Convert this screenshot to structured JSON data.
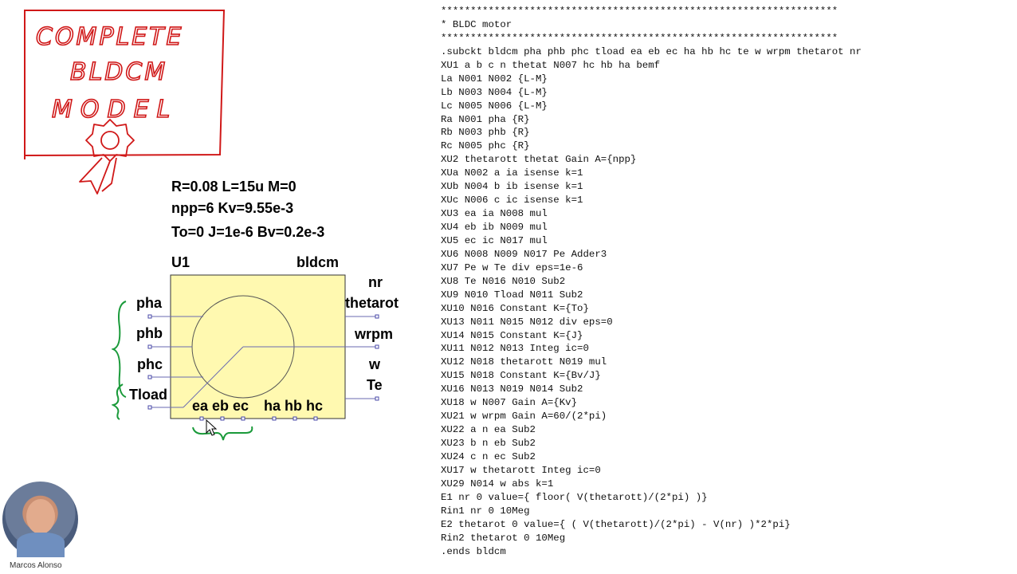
{
  "annotation": {
    "title_lines": [
      "COMPLETE",
      "BLDCM",
      "MODEL"
    ]
  },
  "params": {
    "line1": "R=0.08 L=15u M=0",
    "line2": "npp=6 Kv=9.55e-3",
    "line3": "To=0 J=1e-6 Bv=0.2e-3"
  },
  "symbol": {
    "instance": "U1",
    "model": "bldcm",
    "left_pins": [
      "pha",
      "phb",
      "phc",
      "Tload"
    ],
    "right_pins": [
      "nr",
      "thetarot",
      "wrpm",
      "w",
      "Te"
    ],
    "bottom_pins": "ea eb ec",
    "bottom_pins2": "ha hb hc",
    "fill_color": "#fff9b0",
    "bracket_color": "#1a9a3a"
  },
  "netlist": {
    "lines": [
      "*******************************************************************",
      "* BLDC motor",
      "*******************************************************************",
      ".subckt bldcm pha phb phc tload ea eb ec ha hb hc te w wrpm thetarot nr",
      "XU1 a b c n thetat N007 hc hb ha bemf",
      "La N001 N002 {L-M}",
      "Lb N003 N004 {L-M}",
      "Lc N005 N006 {L-M}",
      "Ra N001 pha {R}",
      "Rb N003 phb {R}",
      "Rc N005 phc {R}",
      "XU2 thetarott thetat Gain A={npp}",
      "XUa N002 a ia isense k=1",
      "XUb N004 b ib isense k=1",
      "XUc N006 c ic isense k=1",
      "XU3 ea ia N008 mul",
      "XU4 eb ib N009 mul",
      "XU5 ec ic N017 mul",
      "XU6 N008 N009 N017 Pe Adder3",
      "XU7 Pe w Te div eps=1e-6",
      "XU8 Te N016 N010 Sub2",
      "XU9 N010 Tload N011 Sub2",
      "XU10 N016 Constant K={To}",
      "XU13 N011 N015 N012 div eps=0",
      "XU14 N015 Constant K={J}",
      "XU11 N012 N013 Integ ic=0",
      "XU12 N018 thetarott N019 mul",
      "XU15 N018 Constant K={Bv/J}",
      "XU16 N013 N019 N014 Sub2",
      "XU18 w N007 Gain A={Kv}",
      "XU21 w wrpm Gain A=60/(2*pi)",
      "XU22 a n ea Sub2",
      "XU23 b n eb Sub2",
      "XU24 c n ec Sub2",
      "XU17 w thetarott Integ ic=0",
      "XU29 N014 w abs k=1",
      "E1 nr 0 value={ floor( V(thetarott)/(2*pi) )}",
      "Rin1 nr 0 10Meg",
      "E2 thetarot 0 value={ ( V(thetarott)/(2*pi) - V(nr) )*2*pi}",
      "Rin2 thetarot 0 10Meg",
      ".ends bldcm"
    ]
  },
  "webcam": {
    "name": "Marcos Alonso"
  }
}
